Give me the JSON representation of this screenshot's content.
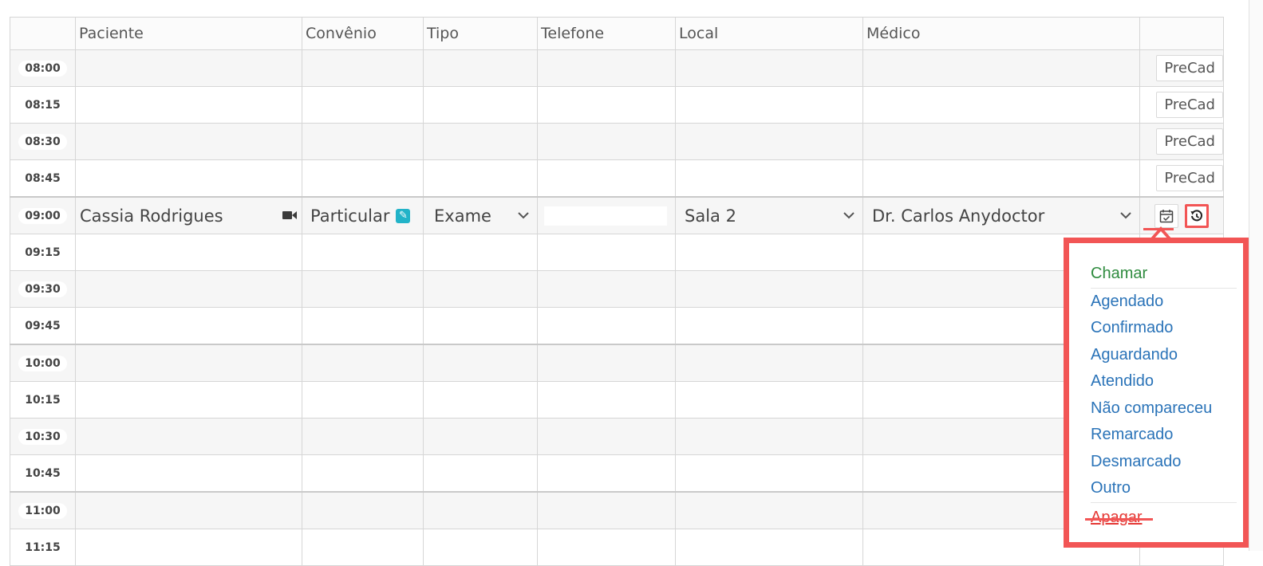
{
  "headers": {
    "time": "",
    "paciente": "Paciente",
    "convenio": "Convênio",
    "tipo": "Tipo",
    "telefone": "Telefone",
    "local": "Local",
    "medico": "Médico",
    "acoes": ""
  },
  "precad_label": "PreCad",
  "rows": [
    {
      "time": "08:00"
    },
    {
      "time": "08:15"
    },
    {
      "time": "08:30"
    },
    {
      "time": "08:45"
    },
    {
      "time": "09:00",
      "paciente": "Cassia Rodrigues",
      "convenio": "Particular",
      "tipo": "Exame",
      "telefone": "",
      "local": "Sala 2",
      "medico": "Dr. Carlos Anydoctor"
    },
    {
      "time": "09:15"
    },
    {
      "time": "09:30"
    },
    {
      "time": "09:45"
    },
    {
      "time": "10:00"
    },
    {
      "time": "10:15"
    },
    {
      "time": "10:30"
    },
    {
      "time": "10:45"
    },
    {
      "time": "11:00"
    },
    {
      "time": "11:15"
    }
  ],
  "status_menu": {
    "call": "Chamar",
    "items": [
      "Agendado",
      "Confirmado",
      "Aguardando",
      "Atendido",
      "Não compareceu",
      "Remarcado",
      "Desmarcado",
      "Outro"
    ],
    "delete": "Apagar"
  },
  "icons": {
    "video": "video-camera-icon",
    "edit": "pencil-edit-icon",
    "calendar": "calendar-check-icon",
    "history": "history-icon",
    "chevron": "chevron-down-icon"
  },
  "colors": {
    "highlight": "#f25555",
    "link": "#2a73b8",
    "call": "#2e8b3e",
    "delete": "#e53935",
    "edit_badge": "#22b3c8"
  }
}
